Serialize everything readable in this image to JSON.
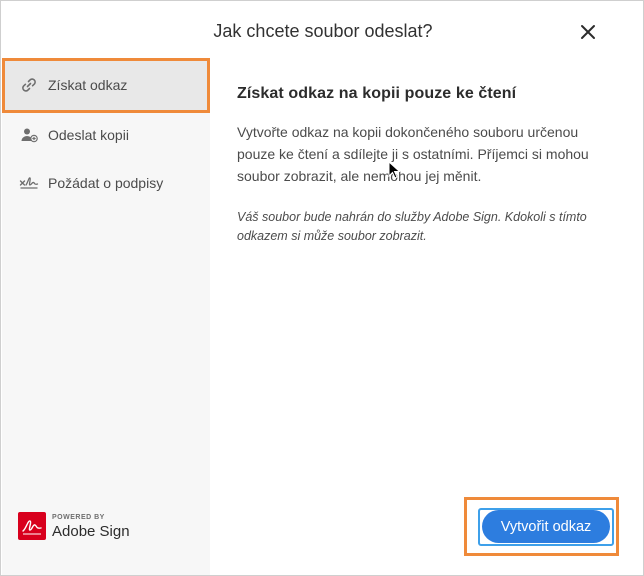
{
  "dialog": {
    "title": "Jak chcete soubor odeslat?",
    "close_icon": "close-icon"
  },
  "sidebar": {
    "items": [
      {
        "label": "Získat odkaz",
        "icon": "link-icon",
        "selected": true
      },
      {
        "label": "Odeslat kopii",
        "icon": "add-person-icon",
        "selected": false
      },
      {
        "label": "Požádat o podpisy",
        "icon": "signature-icon",
        "selected": false
      }
    ]
  },
  "content": {
    "heading": "Získat odkaz na kopii pouze ke čtení",
    "body": "Vytvořte odkaz na kopii dokončeného souboru určenou pouze ke čtení a sdílejte ji s ostatními. Příjemci si mohou soubor zobrazit, ale nemohou jej měnit.",
    "note": "Váš soubor bude nahrán do služby Adobe Sign. Kdokoli s tímto odkazem si může soubor zobrazit."
  },
  "footer": {
    "powered_by": "POWERED BY",
    "brand_name": "Adobe Sign",
    "primary_button": "Vytvořit odkaz"
  },
  "colors": {
    "accent": "#2d7ddf",
    "highlight": "#ef8a3a",
    "brand_red": "#d8001d"
  }
}
